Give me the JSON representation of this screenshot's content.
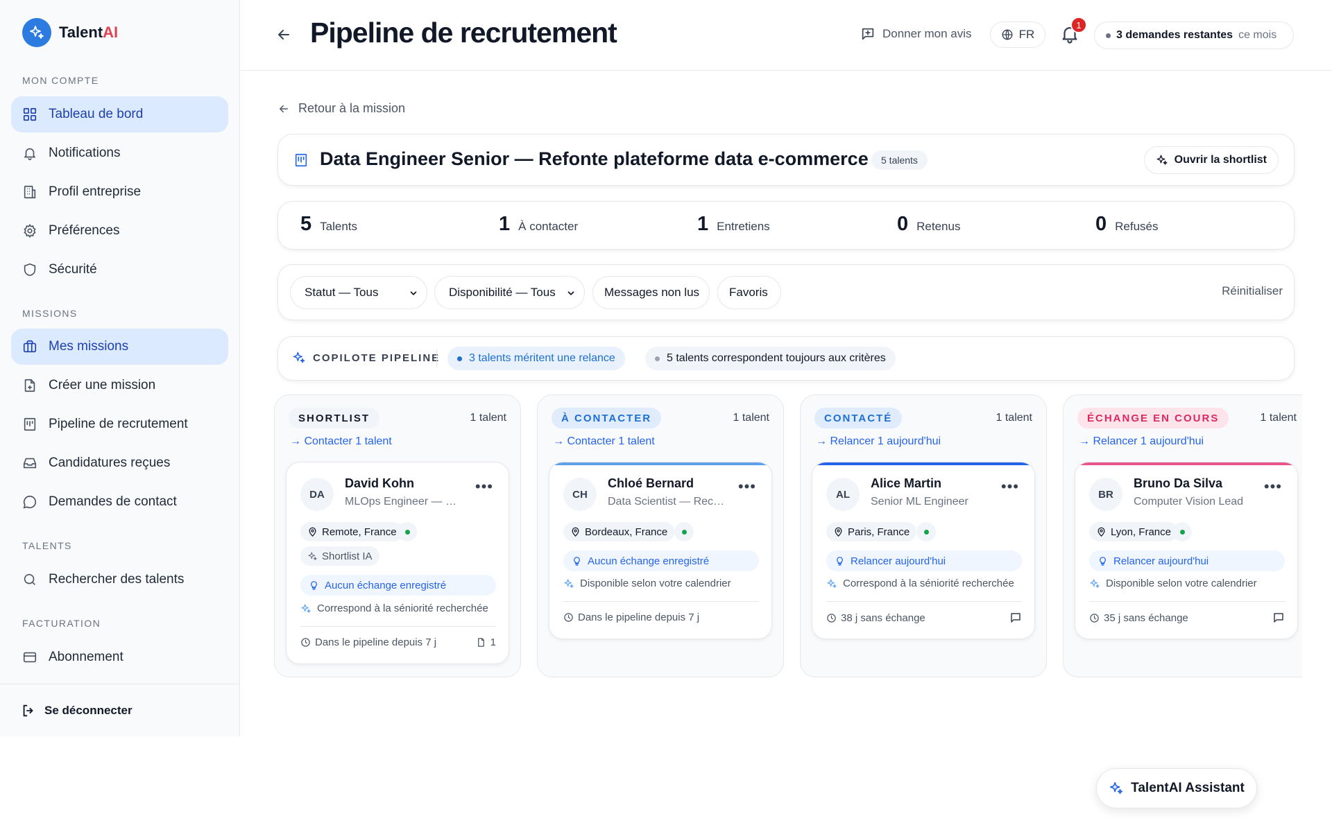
{
  "app": {
    "name_main": "Talent",
    "name_accent": "AI"
  },
  "sidebar": {
    "sections": [
      "MON COMPTE",
      "MISSIONS",
      "TALENTS",
      "FACTURATION"
    ],
    "items": [
      {
        "label": "Tableau de bord",
        "icon": "dashboard-icon"
      },
      {
        "label": "Notifications",
        "icon": "bell-icon"
      },
      {
        "label": "Profil entreprise",
        "icon": "building-icon"
      },
      {
        "label": "Préférences",
        "icon": "gear-icon"
      },
      {
        "label": "Sécurité",
        "icon": "shield-icon"
      },
      {
        "label": "Mes missions",
        "icon": "briefcase-icon"
      },
      {
        "label": "Créer une mission",
        "icon": "file-plus-icon"
      },
      {
        "label": "Pipeline de recrutement",
        "icon": "kanban-icon"
      },
      {
        "label": "Candidatures reçues",
        "icon": "inbox-icon"
      },
      {
        "label": "Demandes de contact",
        "icon": "chat-icon"
      },
      {
        "label": "Rechercher des talents",
        "icon": "search-icon"
      },
      {
        "label": "Abonnement",
        "icon": "credit-card-icon"
      }
    ],
    "logout": "Se déconnecter"
  },
  "header": {
    "title": "Pipeline de recrutement",
    "feedback": "Donner mon avis",
    "lang": "FR",
    "notif_count": "1",
    "quota_main": "3 demandes restantes",
    "quota_suffix": "ce mois"
  },
  "back_link": "Retour à la mission",
  "mission": {
    "title": "Data Engineer Senior — Refonte plateforme data e-commerce",
    "badge": "5 talents",
    "shortlist_button": "Ouvrir la shortlist"
  },
  "stats": [
    {
      "value": "5",
      "label": "Talents"
    },
    {
      "value": "1",
      "label": "À contacter"
    },
    {
      "value": "1",
      "label": "Entretiens"
    },
    {
      "value": "0",
      "label": "Retenus"
    },
    {
      "value": "0",
      "label": "Refusés"
    }
  ],
  "filters": {
    "status": "Statut — Tous",
    "availability": "Disponibilité — Tous",
    "unread": "Messages non lus",
    "favorites": "Favoris",
    "reset": "Réinitialiser"
  },
  "copilot": {
    "label": "COPILOTE PIPELINE",
    "hint1": "3 talents méritent une relance",
    "hint2": "5 talents correspondent toujours aux critères"
  },
  "columns": [
    {
      "title": "SHORTLIST",
      "count": "1 talent",
      "action": "→ Contacter 1 talent",
      "badge_bg": "#f1f5f9",
      "badge_fg": "#111827",
      "bar": "",
      "card": {
        "initials": "DA",
        "name": "David Kohn",
        "role": "MLOps Engineer — Platform",
        "location": "Remote, France",
        "chip": "Shortlist IA",
        "status": "Aucun échange enregistré",
        "match": "Correspond à la séniorité recherchée",
        "footer": "Dans le pipeline depuis 7 j",
        "docs": "1"
      }
    },
    {
      "title": "À CONTACTER",
      "count": "1 talent",
      "action": "→ Contacter 1 talent",
      "badge_bg": "#e0ecfb",
      "badge_fg": "#1d6fd1",
      "bar": "#5fa0e6",
      "card": {
        "initials": "CH",
        "name": "Chloé Bernard",
        "role": "Data Scientist — Recommandation",
        "location": "Bordeaux, France",
        "status": "Aucun échange enregistré",
        "match": "Disponible selon votre calendrier",
        "footer": "Dans le pipeline depuis 7 j"
      }
    },
    {
      "title": "CONTACTÉ",
      "count": "1 talent",
      "action": "→ Relancer 1 aujourd'hui",
      "badge_bg": "#e0ecfb",
      "badge_fg": "#1d6fd1",
      "bar": "#2563eb",
      "card": {
        "initials": "AL",
        "name": "Alice Martin",
        "role": "Senior ML Engineer",
        "location": "Paris, France",
        "status": "Relancer aujourd'hui",
        "match": "Correspond à la séniorité recherchée",
        "footer": "38 j sans échange"
      }
    },
    {
      "title": "ÉCHANGE EN COURS",
      "count": "1 talent",
      "action": "→ Relancer 1 aujourd'hui",
      "badge_bg": "#fde4ea",
      "badge_fg": "#db2763",
      "bar": "#e8558a",
      "card": {
        "initials": "BR",
        "name": "Bruno Da Silva",
        "role": "Computer Vision Lead",
        "location": "Lyon, France",
        "status": "Relancer aujourd'hui",
        "match": "Disponible selon votre calendrier",
        "footer": "35 j sans échange"
      }
    }
  ],
  "assistant": "TalentAI Assistant",
  "colors": {
    "accent": "#2b7be0",
    "brand_red": "#e0424f",
    "active_bg": "#dbeafe"
  }
}
